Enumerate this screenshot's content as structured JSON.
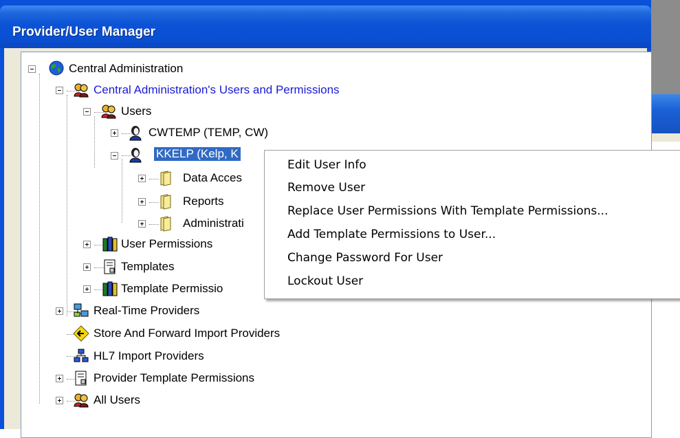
{
  "window": {
    "title": "Provider/User Manager"
  },
  "tree": {
    "root": {
      "label": "Central Administration",
      "icon": "globe-icon"
    },
    "users_permissions": {
      "label": "Central Administration's Users and Permissions",
      "icon": "users-icon"
    },
    "users": {
      "label": "Users",
      "icon": "users-icon"
    },
    "user1": {
      "label": "CWTEMP (TEMP, CW)",
      "icon": "user-icon"
    },
    "user2": {
      "label": "KKELP (Kelp, K",
      "icon": "user-icon"
    },
    "data_access": {
      "label": "Data Acces",
      "icon": "folder-icon"
    },
    "reports": {
      "label": "Reports",
      "icon": "folder-icon"
    },
    "administration": {
      "label": "Administrati",
      "icon": "folder-icon"
    },
    "user_permissions": {
      "label": "User Permissions",
      "icon": "books-icon"
    },
    "templates": {
      "label": "Templates",
      "icon": "document-icon"
    },
    "template_permissions": {
      "label": "Template Permissio",
      "icon": "books-icon"
    },
    "realtime": {
      "label": "Real-Time Providers",
      "icon": "network-icon"
    },
    "store_forward": {
      "label": "Store And Forward Import Providers",
      "icon": "diamond-arrow-icon"
    },
    "hl7": {
      "label": "HL7 Import Providers",
      "icon": "hierarchy-icon"
    },
    "provider_template": {
      "label": "Provider Template Permissions",
      "icon": "document-icon"
    },
    "all_users": {
      "label": "All Users",
      "icon": "users-icon"
    }
  },
  "context_menu": {
    "items": [
      "Edit User Info",
      "Remove User",
      "Replace User Permissions With Template Permissions...",
      "Add Template Permissions to User...",
      "Change Password For User",
      "Lockout User"
    ]
  },
  "colors": {
    "titlebar": "#0a4fd2",
    "selection": "#316ac5",
    "link": "#1a1ad8"
  }
}
